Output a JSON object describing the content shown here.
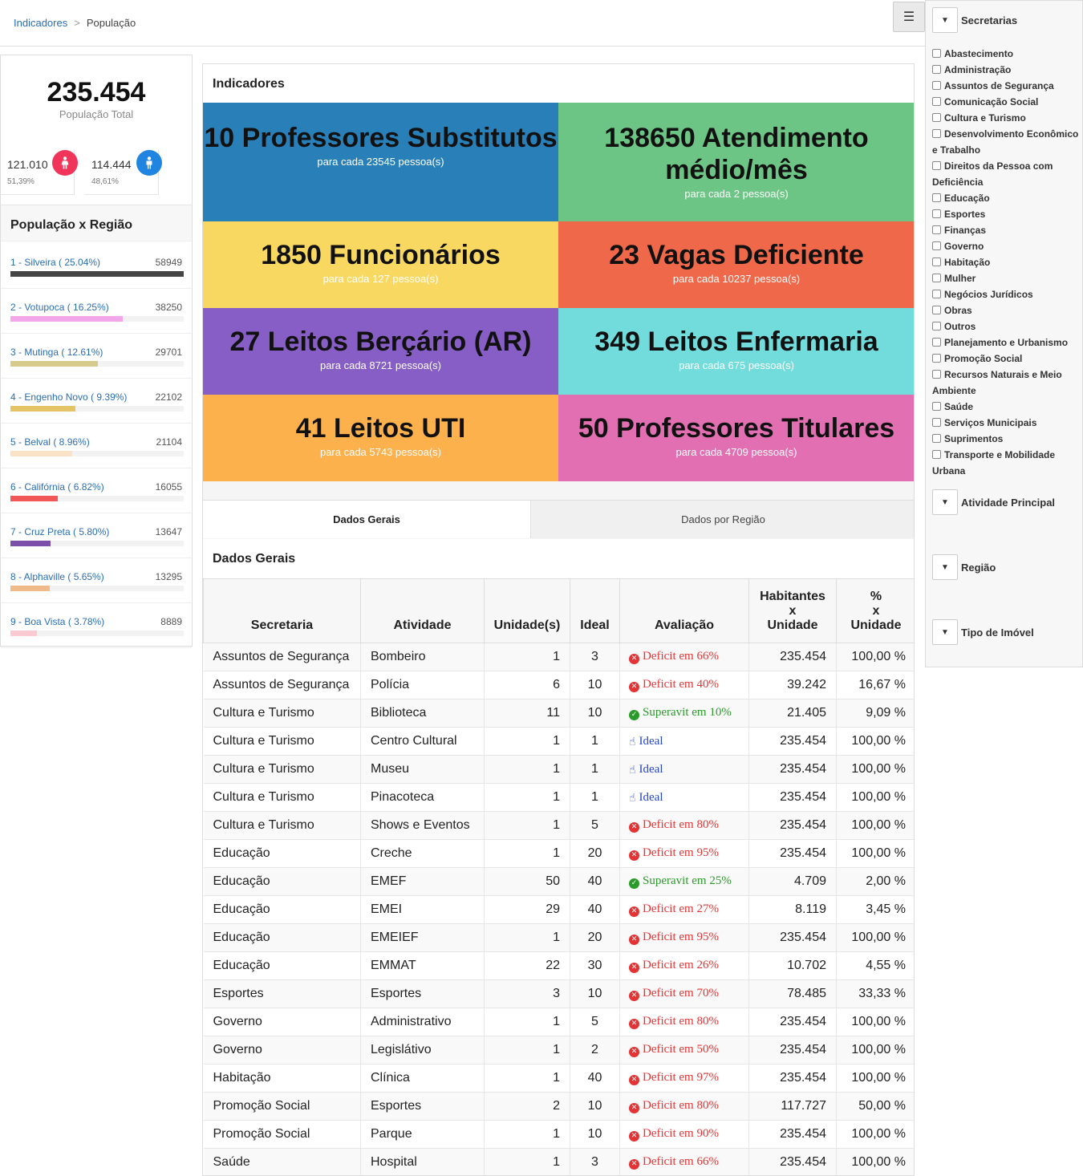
{
  "breadcrumb": {
    "root": "Indicadores",
    "sep": ">",
    "current": "População"
  },
  "menu_icon": "hamburger-icon",
  "population": {
    "total": "235.454",
    "total_label": "População Total",
    "female": {
      "value": "121.010",
      "pct": "51,39%",
      "icon": "female-icon"
    },
    "male": {
      "value": "114.444",
      "pct": "48,61%",
      "icon": "male-icon"
    }
  },
  "regions": {
    "title": "População x Região",
    "items": [
      {
        "label": "1 - Silveira ( 25.04%)",
        "value": "58949",
        "fraction": 1.0,
        "color": "#454545"
      },
      {
        "label": "2 - Votupoca ( 16.25%)",
        "value": "38250",
        "fraction": 0.649,
        "color": "#f3a6ea"
      },
      {
        "label": "3 - Mutinga ( 12.61%)",
        "value": "29701",
        "fraction": 0.504,
        "color": "#d6ca8c"
      },
      {
        "label": "4 - Engenho Novo ( 9.39%)",
        "value": "22102",
        "fraction": 0.375,
        "color": "#e5c466"
      },
      {
        "label": "5 - Belval ( 8.96%)",
        "value": "21104",
        "fraction": 0.358,
        "color": "#fbe2c6"
      },
      {
        "label": "6 - Califórnia ( 6.82%)",
        "value": "16055",
        "fraction": 0.272,
        "color": "#f25757"
      },
      {
        "label": "7 - Cruz Preta ( 5.80%)",
        "value": "13647",
        "fraction": 0.232,
        "color": "#7e4fa8"
      },
      {
        "label": "8 - Alphaville ( 5.65%)",
        "value": "13295",
        "fraction": 0.226,
        "color": "#f0b98a"
      },
      {
        "label": "9 - Boa Vista ( 3.78%)",
        "value": "8889",
        "fraction": 0.151,
        "color": "#fbc9d1"
      }
    ]
  },
  "indicators": {
    "title": "Indicadores",
    "tiles": [
      {
        "main": "10 Professores Substitutos",
        "sub": "para cada 23545 pessoa(s)",
        "color": "#2980b9"
      },
      {
        "main": "138650 Atendimento médio/mês",
        "sub": "para cada 2 pessoa(s)",
        "color": "#6cc584"
      },
      {
        "main": "1850 Funcionários",
        "sub": "para cada 127 pessoa(s)",
        "color": "#f9d862"
      },
      {
        "main": "23 Vagas Deficiente",
        "sub": "para cada 10237 pessoa(s)",
        "color": "#ee6849"
      },
      {
        "main": "27 Leitos Berçário (AR)",
        "sub": "para cada 8721 pessoa(s)",
        "color": "#865ec6"
      },
      {
        "main": "349 Leitos Enfermaria",
        "sub": "para cada 675 pessoa(s)",
        "color": "#72dcdc"
      },
      {
        "main": "41 Leitos UTI",
        "sub": "para cada 5743 pessoa(s)",
        "color": "#fdb14c"
      },
      {
        "main": "50 Professores Titulares",
        "sub": "para cada 4709 pessoa(s)",
        "color": "#e16fb2"
      }
    ]
  },
  "tabs": {
    "active": "Dados Gerais",
    "inactive": "Dados por Região"
  },
  "table": {
    "title": "Dados Gerais",
    "headers": [
      "Secretaria",
      "Atividade",
      "Unidade(s)",
      "Ideal",
      "Avaliação",
      "Habitantes x Unidade",
      "% x Unidade"
    ],
    "rows": [
      {
        "secretaria": "Assuntos de Segurança",
        "atividade": "Bombeiro",
        "unidades": "1",
        "ideal": "3",
        "avaliacao": "Deficit em 66%",
        "status": "deficit",
        "habitantes": "235.454",
        "pct": "100,00 %"
      },
      {
        "secretaria": "Assuntos de Segurança",
        "atividade": "Polícia",
        "unidades": "6",
        "ideal": "10",
        "avaliacao": "Deficit em 40%",
        "status": "deficit",
        "habitantes": "39.242",
        "pct": "16,67 %"
      },
      {
        "secretaria": "Cultura e Turismo",
        "atividade": "Biblioteca",
        "unidades": "11",
        "ideal": "10",
        "avaliacao": "Superavit em 10%",
        "status": "super",
        "habitantes": "21.405",
        "pct": "9,09 %"
      },
      {
        "secretaria": "Cultura e Turismo",
        "atividade": "Centro Cultural",
        "unidades": "1",
        "ideal": "1",
        "avaliacao": "Ideal",
        "status": "ideal",
        "habitantes": "235.454",
        "pct": "100,00 %"
      },
      {
        "secretaria": "Cultura e Turismo",
        "atividade": "Museu",
        "unidades": "1",
        "ideal": "1",
        "avaliacao": "Ideal",
        "status": "ideal",
        "habitantes": "235.454",
        "pct": "100,00 %"
      },
      {
        "secretaria": "Cultura e Turismo",
        "atividade": "Pinacoteca",
        "unidades": "1",
        "ideal": "1",
        "avaliacao": "Ideal",
        "status": "ideal",
        "habitantes": "235.454",
        "pct": "100,00 %"
      },
      {
        "secretaria": "Cultura e Turismo",
        "atividade": "Shows e Eventos",
        "unidades": "1",
        "ideal": "5",
        "avaliacao": "Deficit em 80%",
        "status": "deficit",
        "habitantes": "235.454",
        "pct": "100,00 %"
      },
      {
        "secretaria": "Educação",
        "atividade": "Creche",
        "unidades": "1",
        "ideal": "20",
        "avaliacao": "Deficit em 95%",
        "status": "deficit",
        "habitantes": "235.454",
        "pct": "100,00 %"
      },
      {
        "secretaria": "Educação",
        "atividade": "EMEF",
        "unidades": "50",
        "ideal": "40",
        "avaliacao": "Superavit em 25%",
        "status": "super",
        "habitantes": "4.709",
        "pct": "2,00 %"
      },
      {
        "secretaria": "Educação",
        "atividade": "EMEI",
        "unidades": "29",
        "ideal": "40",
        "avaliacao": "Deficit em 27%",
        "status": "deficit",
        "habitantes": "8.119",
        "pct": "3,45 %"
      },
      {
        "secretaria": "Educação",
        "atividade": "EMEIEF",
        "unidades": "1",
        "ideal": "20",
        "avaliacao": "Deficit em 95%",
        "status": "deficit",
        "habitantes": "235.454",
        "pct": "100,00 %"
      },
      {
        "secretaria": "Educação",
        "atividade": "EMMAT",
        "unidades": "22",
        "ideal": "30",
        "avaliacao": "Deficit em 26%",
        "status": "deficit",
        "habitantes": "10.702",
        "pct": "4,55 %"
      },
      {
        "secretaria": "Esportes",
        "atividade": "Esportes",
        "unidades": "3",
        "ideal": "10",
        "avaliacao": "Deficit em 70%",
        "status": "deficit",
        "habitantes": "78.485",
        "pct": "33,33 %"
      },
      {
        "secretaria": "Governo",
        "atividade": "Administrativo",
        "unidades": "1",
        "ideal": "5",
        "avaliacao": "Deficit em 80%",
        "status": "deficit",
        "habitantes": "235.454",
        "pct": "100,00 %"
      },
      {
        "secretaria": "Governo",
        "atividade": "Legislátivo",
        "unidades": "1",
        "ideal": "2",
        "avaliacao": "Deficit em 50%",
        "status": "deficit",
        "habitantes": "235.454",
        "pct": "100,00 %"
      },
      {
        "secretaria": "Habitação",
        "atividade": "Clínica",
        "unidades": "1",
        "ideal": "40",
        "avaliacao": "Deficit em 97%",
        "status": "deficit",
        "habitantes": "235.454",
        "pct": "100,00 %"
      },
      {
        "secretaria": "Promoção Social",
        "atividade": "Esportes",
        "unidades": "2",
        "ideal": "10",
        "avaliacao": "Deficit em 80%",
        "status": "deficit",
        "habitantes": "117.727",
        "pct": "50,00 %"
      },
      {
        "secretaria": "Promoção Social",
        "atividade": "Parque",
        "unidades": "1",
        "ideal": "10",
        "avaliacao": "Deficit em 90%",
        "status": "deficit",
        "habitantes": "235.454",
        "pct": "100,00 %"
      },
      {
        "secretaria": "Saúde",
        "atividade": "Hospital",
        "unidades": "1",
        "ideal": "3",
        "avaliacao": "Deficit em 66%",
        "status": "deficit",
        "habitantes": "235.454",
        "pct": "100,00 %"
      }
    ]
  },
  "filters": {
    "secretarias": {
      "label": "Secretarias",
      "options": [
        "Abastecimento",
        "Administração",
        "Assuntos de Segurança",
        "Comunicação Social",
        "Cultura e Turismo",
        "Desenvolvimento Econômico e Trabalho",
        "Direitos da Pessoa com Deficiência",
        "Educação",
        "Esportes",
        "Finanças",
        "Governo",
        "Habitação",
        "Mulher",
        "Negócios Jurídicos",
        "Obras",
        "Outros",
        "Planejamento e Urbanismo",
        "Promoção Social",
        "Recursos Naturais e Meio Ambiente",
        "Saúde",
        "Serviços Municipais",
        "Suprimentos",
        "Transporte e Mobilidade Urbana"
      ]
    },
    "atividade": {
      "label": "Atividade Principal"
    },
    "regiao": {
      "label": "Região"
    },
    "imovel": {
      "label": "Tipo de Imóvel"
    }
  }
}
